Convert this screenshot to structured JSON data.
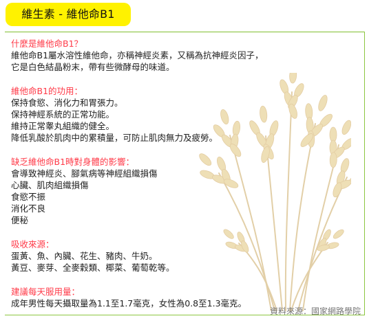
{
  "tab": {
    "title": "維生素 - 維他命B1"
  },
  "sections": {
    "what": {
      "title": "什麼是維他命B1？",
      "lines": [
        "維他命B1屬水溶性維他命，亦稱神經炎素，又稱為抗神經炎因子，",
        "它是白色結晶粉末，帶有些微酵母的味道。"
      ]
    },
    "function": {
      "title": "維他命B1的功用：",
      "lines": [
        "保持食慾、消化力和胃張力。",
        "保持神經系統的正常功能。",
        "維持正常睾丸組織的健全。",
        "降低乳酸於肌肉中的累積量，可防止肌肉無力及疲勞。"
      ]
    },
    "deficiency": {
      "title": "缺乏維他命B1時對身體的影響：",
      "lines": [
        "會導致神經炎、腳氣病等神經組織損傷",
        "心臟、肌肉組織損傷",
        "食慾不振",
        "消化不良",
        "便秘"
      ]
    },
    "sources": {
      "title": "吸收來源：",
      "lines": [
        "蛋黃、魚、內臟、花生、豬肉、牛奶。",
        "黃豆、麥芽、全麥穀類、椰菜、葡萄乾等。"
      ]
    },
    "dosage": {
      "title": "建議每天服用量：",
      "lines": [
        "成年男性每天攝取量為1.1至1.7毫克，女性為0.8至1.3毫克。"
      ]
    }
  },
  "footer": {
    "source": "資料來源：國家網路學院"
  },
  "colors": {
    "tab_background": "#fff200",
    "section_title": "#ff3a48",
    "rule": "#7fbf2d",
    "wheat": "#d7b96b"
  },
  "decoration": {
    "image": "wheat-stalks"
  }
}
